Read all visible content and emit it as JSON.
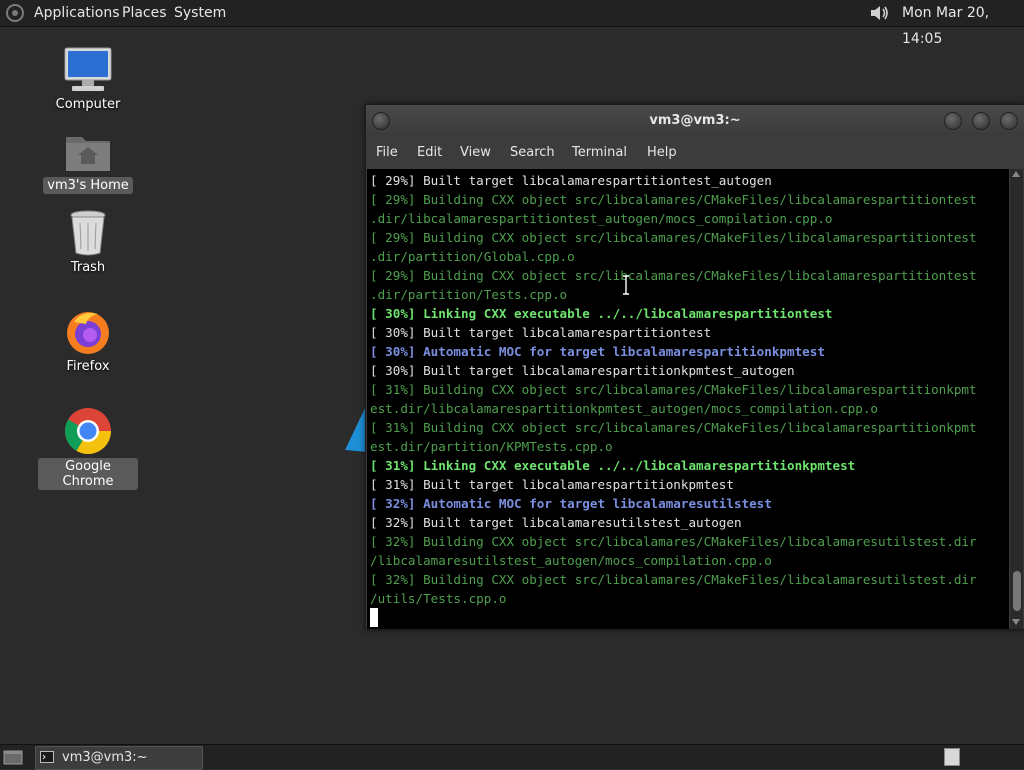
{
  "top_panel": {
    "menus": {
      "applications": "Applications",
      "places": "Places",
      "system": "System"
    },
    "clock": "Mon Mar 20, 14:05",
    "icons": [
      "distro-logo-icon",
      "volume-icon"
    ]
  },
  "desktop": {
    "icons": {
      "computer": "Computer",
      "home": "vm3's Home",
      "trash": "Trash",
      "firefox": "Firefox",
      "chrome": "Google Chrome"
    }
  },
  "terminal": {
    "title": "vm3@vm3:~",
    "menu": {
      "file": "File",
      "edit": "Edit",
      "view": "View",
      "search": "Search",
      "terminal": "Terminal",
      "help": "Help"
    },
    "lines": [
      "[ 29%] Built target libcalamarespartitiontest_autogen",
      "[ 29%] Building CXX object src/libcalamares/CMakeFiles/libcalamarespartitiontest",
      ".dir/libcalamarespartitiontest_autogen/mocs_compilation.cpp.o",
      "[ 29%] Building CXX object src/libcalamares/CMakeFiles/libcalamarespartitiontest",
      ".dir/partition/Global.cpp.o",
      "[ 29%] Building CXX object src/libcalamares/CMakeFiles/libcalamarespartitiontest",
      ".dir/partition/Tests.cpp.o",
      "[ 30%] Linking CXX executable ../../libcalamarespartitiontest",
      "[ 30%] Built target libcalamarespartitiontest",
      "[ 30%] Automatic MOC for target libcalamarespartitionkpmtest",
      "[ 30%] Built target libcalamarespartitionkpmtest_autogen",
      "[ 31%] Building CXX object src/libcalamares/CMakeFiles/libcalamarespartitionkpmt",
      "est.dir/libcalamarespartitionkpmtest_autogen/mocs_compilation.cpp.o",
      "[ 31%] Building CXX object src/libcalamares/CMakeFiles/libcalamarespartitionkpmt",
      "est.dir/partition/KPMTests.cpp.o",
      "[ 31%] Linking CXX executable ../../libcalamarespartitionkpmtest",
      "[ 31%] Built target libcalamarespartitionkpmtest",
      "[ 32%] Automatic MOC for target libcalamaresutilstest",
      "[ 32%] Built target libcalamaresutilstest_autogen",
      "[ 32%] Building CXX object src/libcalamares/CMakeFiles/libcalamaresutilstest.dir",
      "/libcalamaresutilstest_autogen/mocs_compilation.cpp.o",
      "[ 32%] Building CXX object src/libcalamares/CMakeFiles/libcalamaresutilstest.dir",
      "/utils/Tests.cpp.o"
    ],
    "line_styles": [
      "plain",
      "build",
      "build",
      "build",
      "build",
      "build",
      "build",
      "link",
      "plain",
      "moc",
      "plain",
      "build",
      "build",
      "build",
      "build",
      "link",
      "plain",
      "moc",
      "plain",
      "build",
      "build",
      "build",
      "build"
    ],
    "colors": {
      "build": "#4f9f4f",
      "link": "#6ee36e",
      "moc": "#7a8fe0",
      "plain": "#e0e0e0"
    }
  },
  "taskbar": {
    "task_terminal": "vm3@vm3:~",
    "icons": [
      "show-desktop-icon",
      "terminal-icon",
      "workspace-icon"
    ]
  }
}
